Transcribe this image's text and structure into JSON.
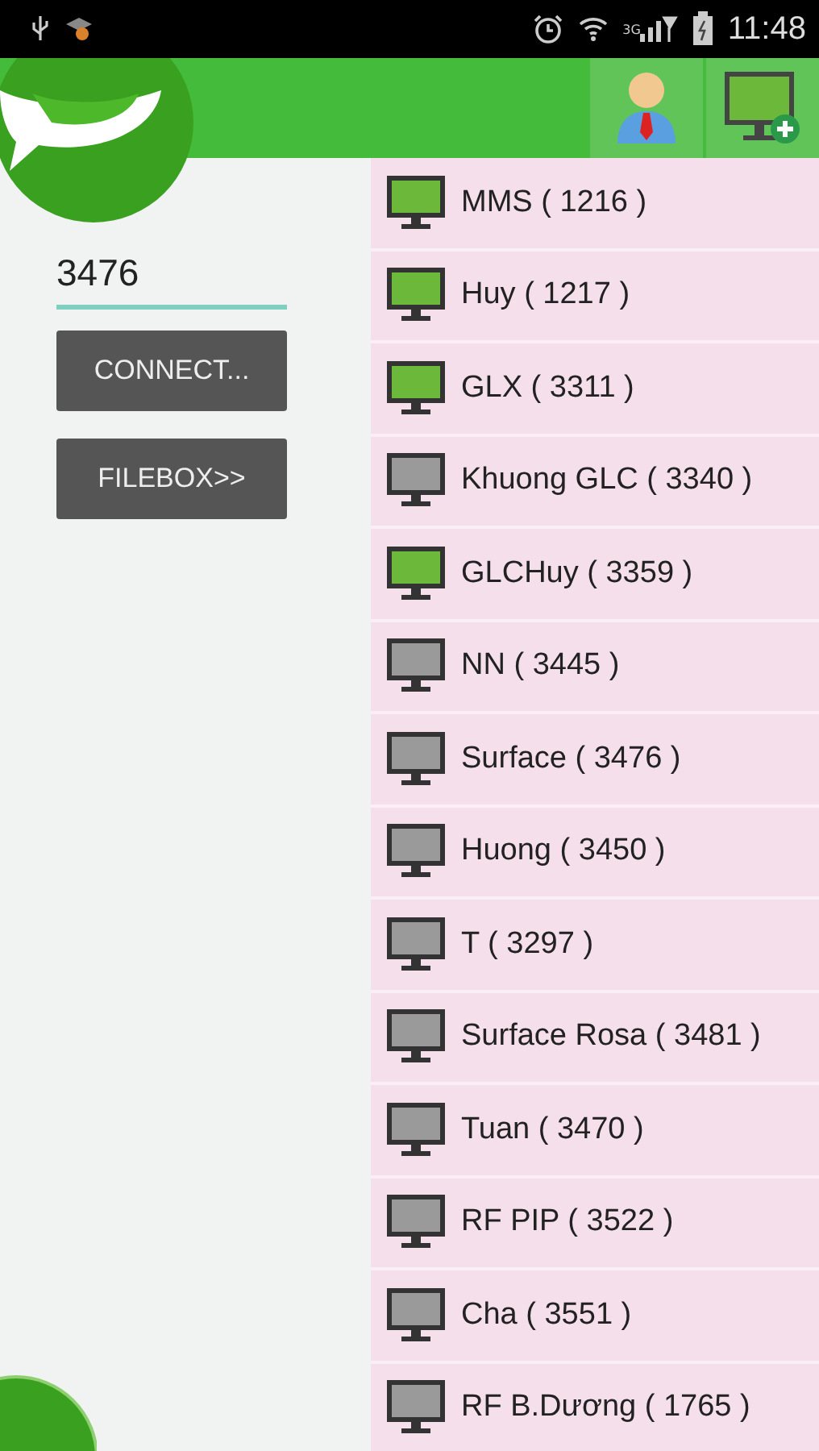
{
  "status_bar": {
    "network": "3G",
    "time": "11:48"
  },
  "connect_panel": {
    "id_field": {
      "value": "3476"
    },
    "buttons": [
      "CONNECT...",
      "FILEBOX>>"
    ]
  },
  "computers": [
    {
      "label": "MMS  ( 1216 )",
      "online": true
    },
    {
      "label": "Huy ( 1217 )",
      "online": true
    },
    {
      "label": "GLX ( 3311 )",
      "online": true
    },
    {
      "label": "Khuong GLC ( 3340 )",
      "online": false
    },
    {
      "label": "GLCHuy ( 3359 )",
      "online": true
    },
    {
      "label": "NN ( 3445 )",
      "online": false
    },
    {
      "label": "Surface ( 3476 )",
      "online": false
    },
    {
      "label": "Huong ( 3450 )",
      "online": false
    },
    {
      "label": "T ( 3297 )",
      "online": false
    },
    {
      "label": "Surface Rosa ( 3481 )",
      "online": false
    },
    {
      "label": "Tuan ( 3470 )",
      "online": false
    },
    {
      "label": "RF PIP ( 3522 )",
      "online": false
    },
    {
      "label": "Cha ( 3551 )",
      "online": false
    },
    {
      "label": "RF B.Dương ( 1765 )",
      "online": false
    }
  ]
}
